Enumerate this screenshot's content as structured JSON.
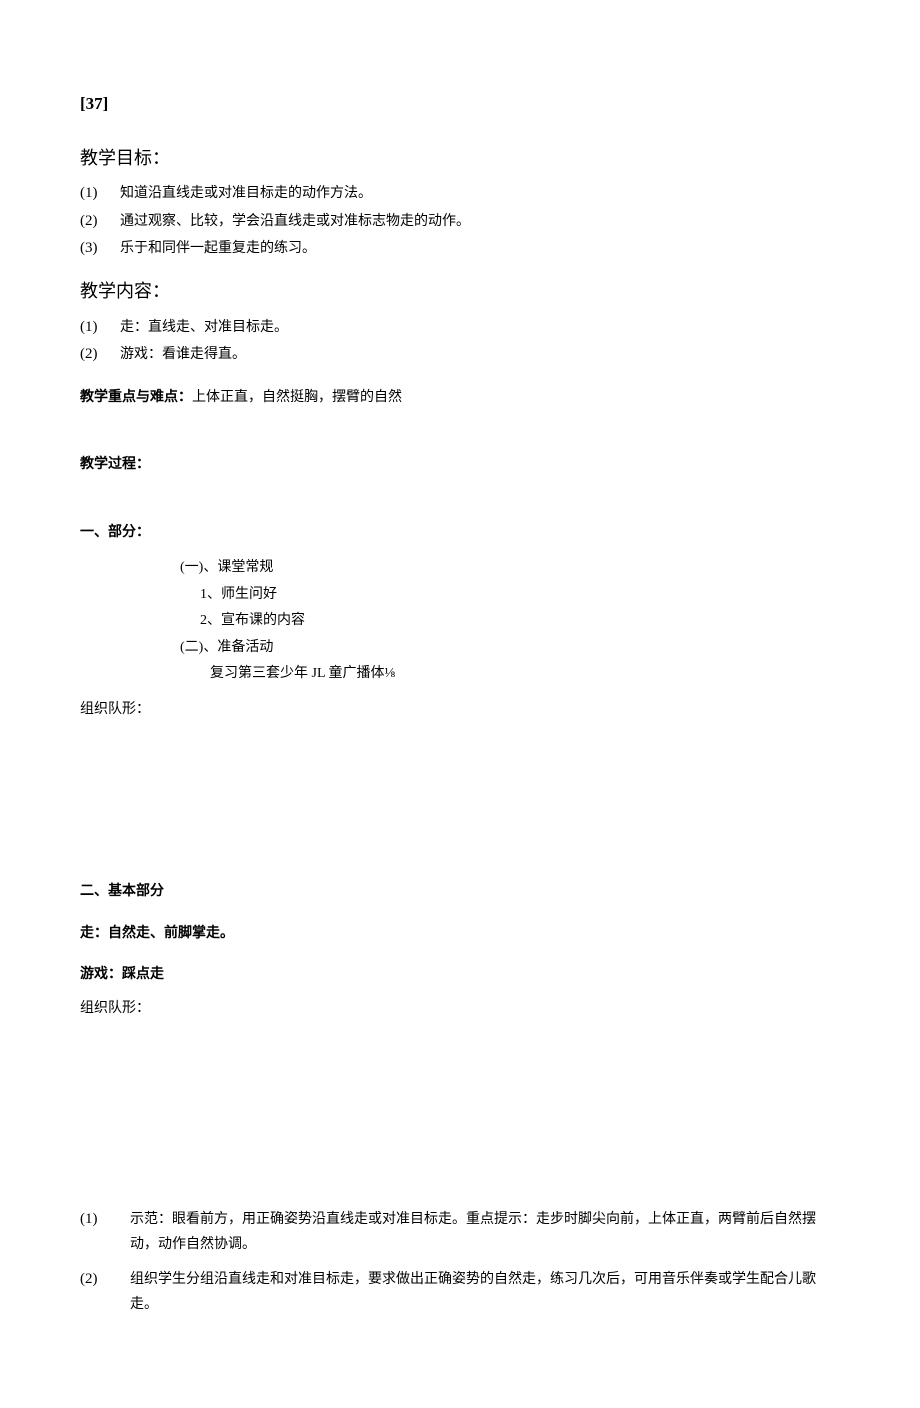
{
  "pageNumber": "[37]",
  "headings": {
    "goals": "教学目标：",
    "content": "教学内容：",
    "keydiff": "教学重点与难点：",
    "keydiffValue": "上体正直，自然挺胸，摆臂的自然",
    "process": "教学过程：",
    "part1": "一、部分：",
    "part2": "二、基本部分",
    "walk": "走：自然走、前脚掌走。",
    "game": "游戏：踩点走"
  },
  "goalsList": [
    {
      "marker": "(1)",
      "text": "知道沿直线走或对准目标走的动作方法。"
    },
    {
      "marker": "(2)",
      "text": "通过观察、比较，学会沿直线走或对准标志物走的动作。"
    },
    {
      "marker": "(3)",
      "text": "乐于和同伴一起重复走的练习。"
    }
  ],
  "contentList": [
    {
      "marker": "(1)",
      "text": "走：直线走、对准目标走。"
    },
    {
      "marker": "(2)",
      "text": "游戏：看谁走得直。"
    }
  ],
  "part1Block": {
    "a": "(一)、课堂常规",
    "a1": "1、师生问好",
    "a2": "2、宣布课的内容",
    "b": "(二)、准备活动",
    "b1": "复习第三套少年 JL 童广播体⅛"
  },
  "formation1": "组织队形：",
  "formation2": "组织队形：",
  "bottomList": [
    {
      "marker": "(1)",
      "text": "示范：眼看前方，用正确姿势沿直线走或对准目标走。重点提示：走步时脚尖向前，上体正直，两臂前后自然摆动，动作自然协调。"
    },
    {
      "marker": "(2)",
      "text": "组织学生分组沿直线走和对准目标走，要求做出正确姿势的自然走，练习几次后，可用音乐伴奏或学生配合儿歌走。"
    }
  ]
}
